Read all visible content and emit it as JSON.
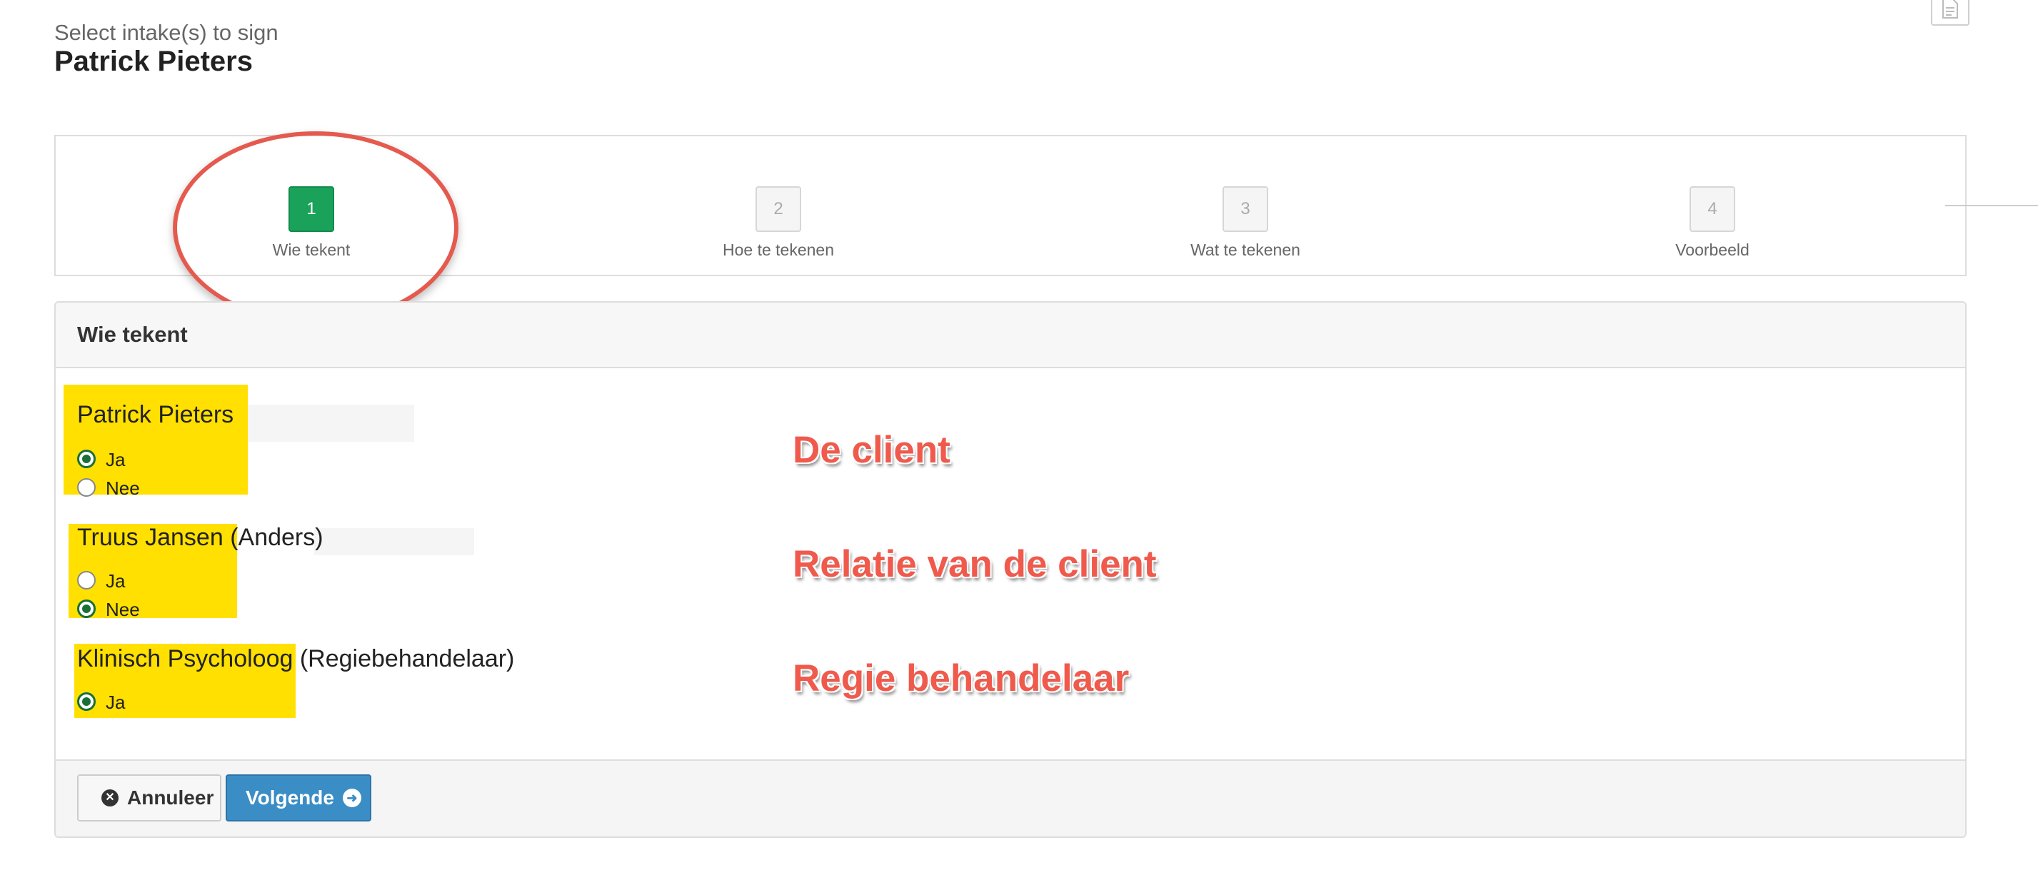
{
  "header": {
    "subtitle": "Select intake(s) to sign",
    "title": "Patrick Pieters"
  },
  "icons": {
    "corner": "document-icon",
    "cancel": "times-circle-icon",
    "next": "arrow-circle-right-icon"
  },
  "wizard": {
    "steps": [
      {
        "number": "1",
        "label": "Wie tekent",
        "active": true
      },
      {
        "number": "2",
        "label": "Hoe te tekenen",
        "active": false
      },
      {
        "number": "3",
        "label": "Wat te tekenen",
        "active": false
      },
      {
        "number": "4",
        "label": "Voorbeeld",
        "active": false
      }
    ]
  },
  "panel": {
    "heading": "Wie tekent",
    "signers": [
      {
        "name": "Patrick Pieters",
        "role": "",
        "options": [
          {
            "label": "Ja",
            "checked": true
          },
          {
            "label": "Nee",
            "checked": false
          }
        ]
      },
      {
        "name": "Truus Jansen",
        "role": "(Anders)",
        "options": [
          {
            "label": "Ja",
            "checked": false
          },
          {
            "label": "Nee",
            "checked": true
          }
        ]
      },
      {
        "name": "Klinisch Psycholoog",
        "role": "(Regiebehandelaar)",
        "options": [
          {
            "label": "Ja",
            "checked": true
          }
        ]
      }
    ]
  },
  "annotations": {
    "client": "De client",
    "relation": "Relatie van de client",
    "regie": "Regie behandelaar"
  },
  "footer": {
    "cancel_label": "Annuleer",
    "next_label": "Volgende"
  },
  "colors": {
    "step_active": "#1aa25a",
    "highlight": "#ffe000",
    "annotation": "#ef5a4c",
    "primary_button": "#3b8dc5",
    "radio_checked": "#1a6f39"
  }
}
